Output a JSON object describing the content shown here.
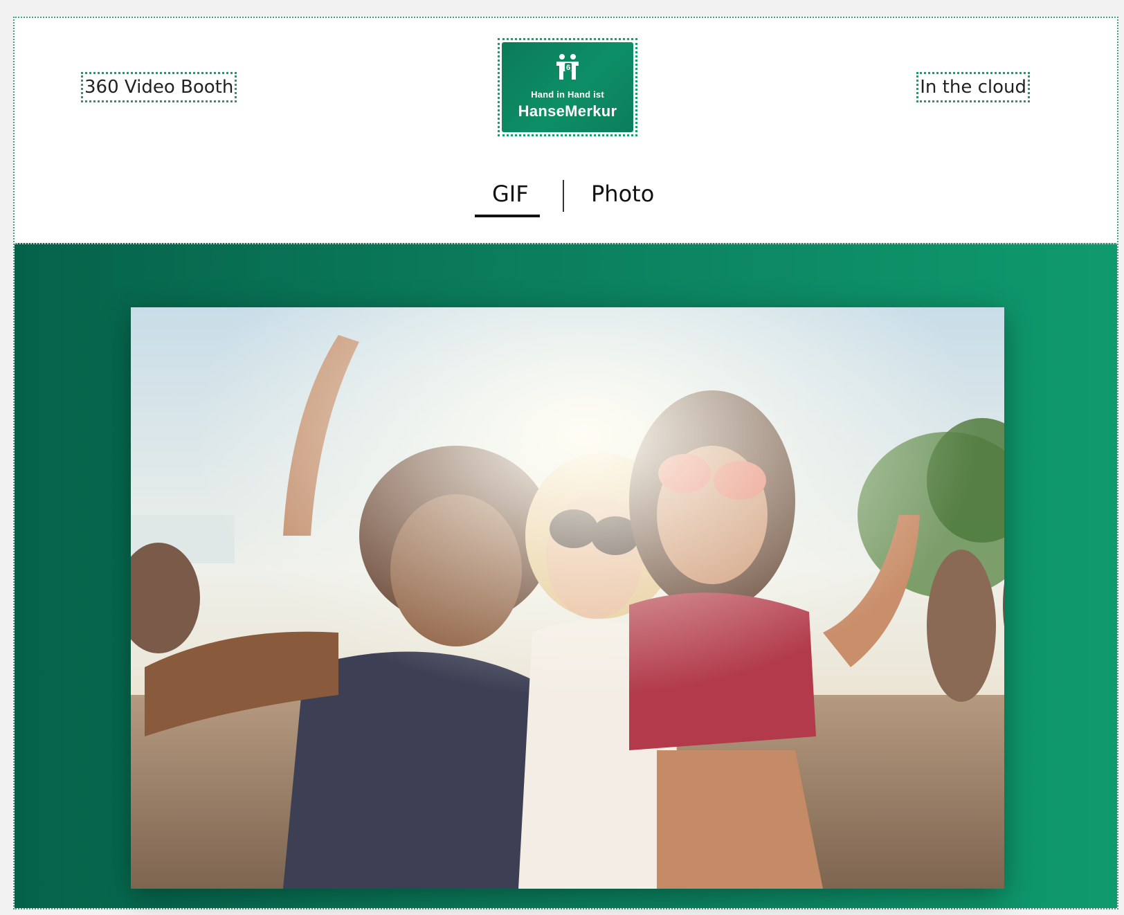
{
  "header": {
    "left_label": "360 Video Booth",
    "right_label": "In the cloud",
    "logo": {
      "tagline": "Hand in Hand ist",
      "brand": "HanseMerkur",
      "icon": "people-group-icon"
    }
  },
  "tabs": [
    {
      "label": "GIF",
      "active": true
    },
    {
      "label": "Photo",
      "active": false
    }
  ],
  "colors": {
    "brand_green": "#0d8f66",
    "brand_green_dark": "#05624a",
    "outline_dotted": "#1f9a6a"
  },
  "gallery": {
    "image": "group-photo-three-women-festival"
  }
}
